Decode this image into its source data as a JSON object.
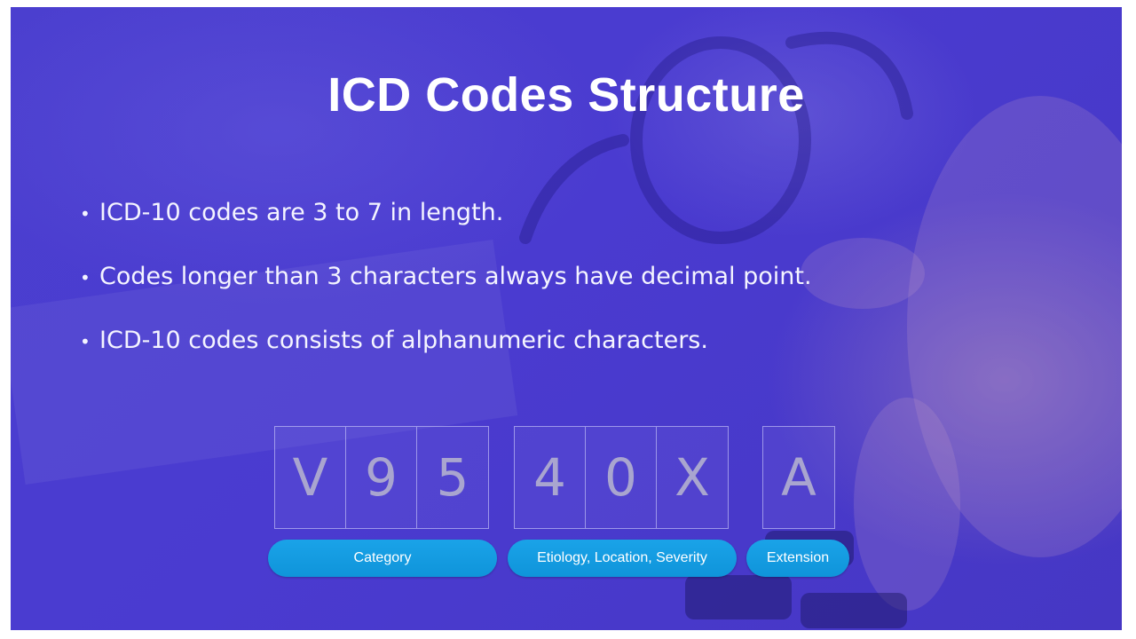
{
  "slide": {
    "title": "ICD Codes Structure",
    "bullets": [
      "ICD-10 codes are 3 to 7 in length.",
      "Codes longer than 3 characters always have decimal point.",
      "ICD-10 codes consists of alphanumeric characters."
    ],
    "code_groups": [
      [
        "V",
        "9",
        "5"
      ],
      [
        "4",
        "0",
        "X"
      ],
      [
        "A"
      ]
    ],
    "labels": [
      "Category",
      "Etiology, Location, Severity",
      "Extension"
    ]
  },
  "colors": {
    "background": "#4a3bd0",
    "pill": "#1aa3e8",
    "title": "#ffffff"
  }
}
